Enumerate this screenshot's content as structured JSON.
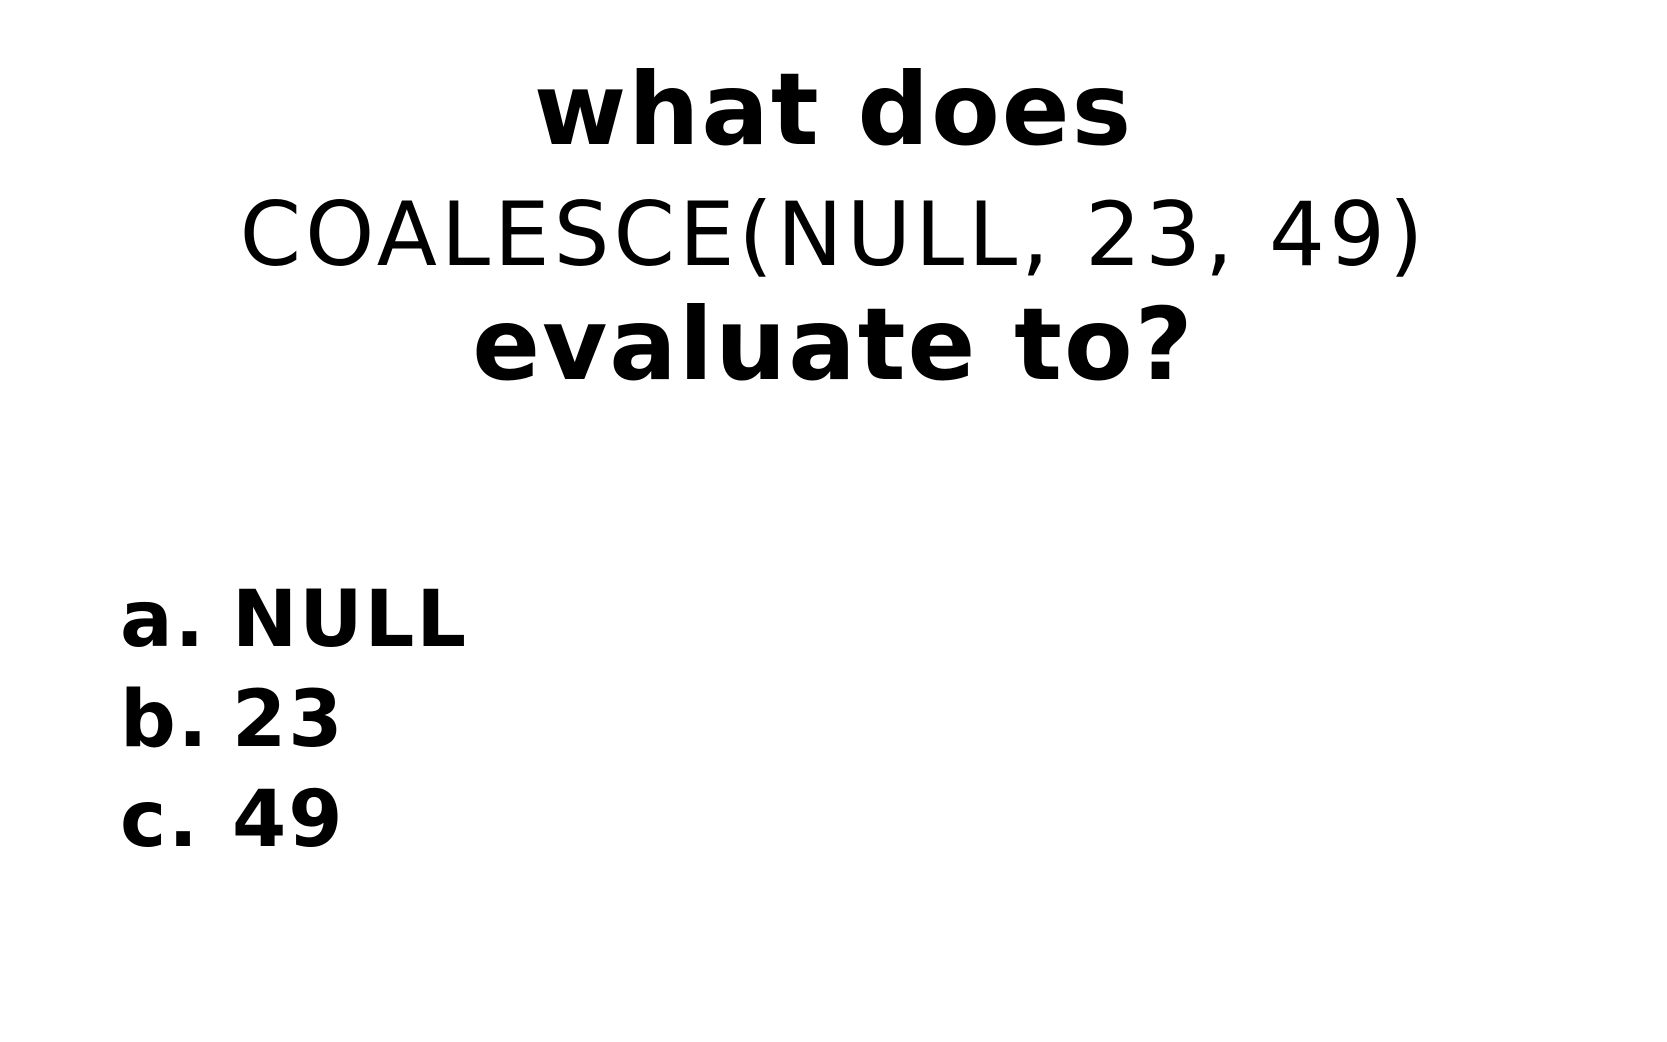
{
  "question": {
    "line1": "what does",
    "code": "COALESCE(NULL, 23, 49)",
    "line3": "evaluate to?"
  },
  "options": [
    {
      "letter": "a.",
      "text": "NULL"
    },
    {
      "letter": "b.",
      "text": "23"
    },
    {
      "letter": "c.",
      "text": "49"
    }
  ]
}
